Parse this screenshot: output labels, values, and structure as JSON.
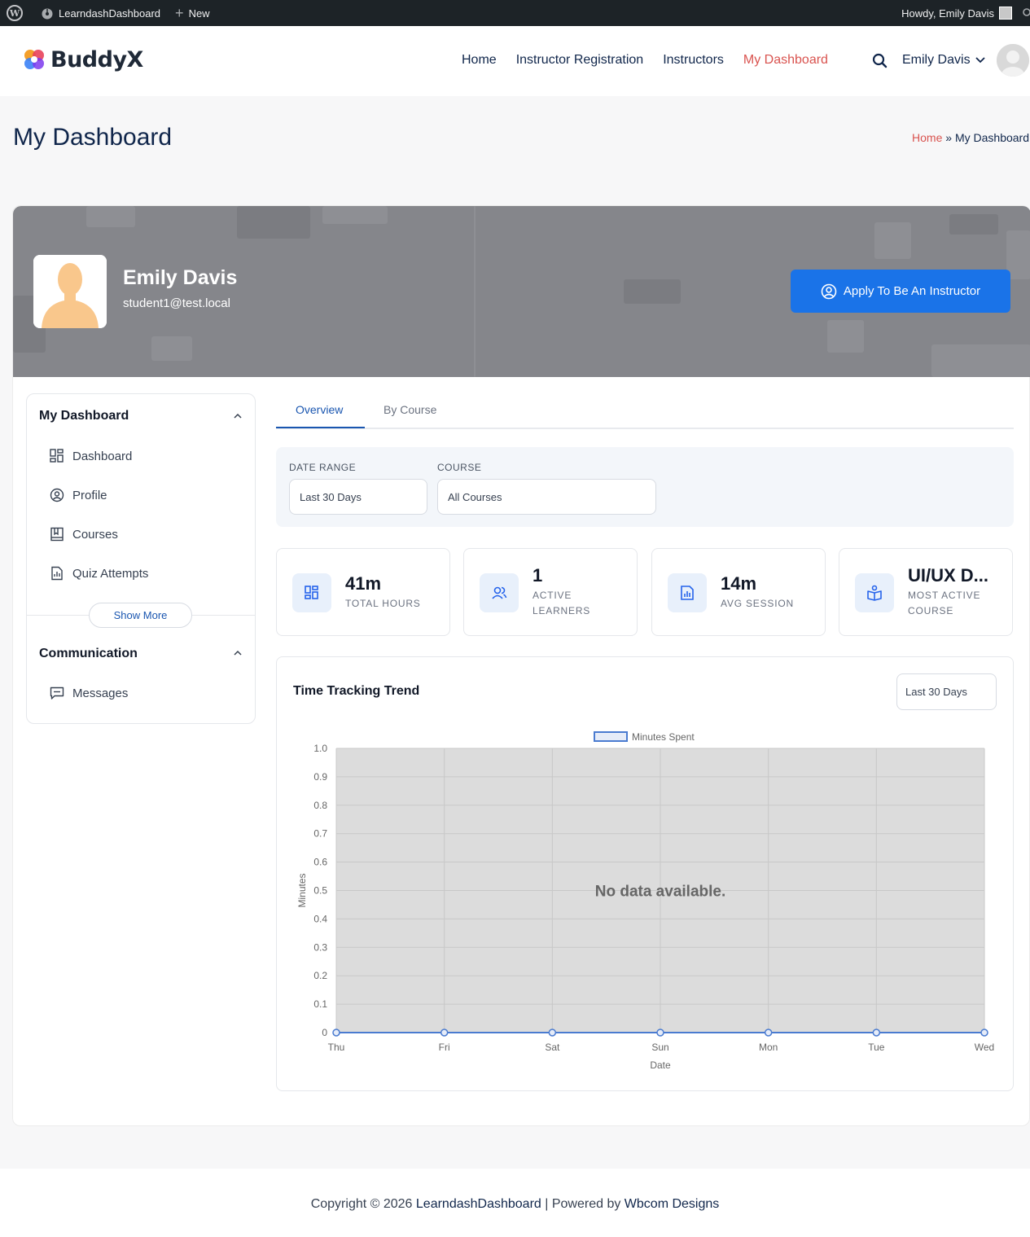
{
  "admin_bar": {
    "site_name": "LearndashDashboard",
    "new_label": "New",
    "howdy": "Howdy, Emily Davis"
  },
  "header": {
    "brand": "BuddyX",
    "nav": [
      {
        "label": "Home",
        "active": false
      },
      {
        "label": "Instructor Registration",
        "active": false
      },
      {
        "label": "Instructors",
        "active": false
      },
      {
        "label": "My Dashboard",
        "active": true
      }
    ],
    "user_name": "Emily Davis"
  },
  "page": {
    "title": "My Dashboard",
    "breadcrumb_home": "Home",
    "breadcrumb_sep": "»",
    "breadcrumb_current": "My Dashboard"
  },
  "profile": {
    "name": "Emily Davis",
    "email": "student1@test.local",
    "apply_label": "Apply To Be An Instructor"
  },
  "sidebar": {
    "section1_title": "My Dashboard",
    "items": [
      {
        "label": "Dashboard",
        "icon": "dashboard-icon"
      },
      {
        "label": "Profile",
        "icon": "profile-icon"
      },
      {
        "label": "Courses",
        "icon": "book-icon"
      },
      {
        "label": "Quiz Attempts",
        "icon": "report-icon"
      }
    ],
    "show_more": "Show More",
    "section2_title": "Communication",
    "messages": "Messages"
  },
  "tabs": [
    {
      "label": "Overview",
      "active": true
    },
    {
      "label": "By Course",
      "active": false
    }
  ],
  "filters": {
    "date_range_label": "DATE RANGE",
    "date_range_value": "Last 30 Days",
    "course_label": "COURSE",
    "course_value": "All Courses"
  },
  "stats": [
    {
      "value": "41m",
      "label_lines": [
        "TOTAL HOURS"
      ],
      "icon": "grid-icon"
    },
    {
      "value": "1",
      "label_lines": [
        "ACTIVE",
        "LEARNERS"
      ],
      "icon": "users-icon"
    },
    {
      "value": "14m",
      "label_lines": [
        "AVG SESSION"
      ],
      "icon": "chart-doc-icon"
    },
    {
      "value": "UI/UX D...",
      "label_lines": [
        "MOST ACTIVE",
        "COURSE"
      ],
      "icon": "course-icon"
    }
  ],
  "chart_card": {
    "title": "Time Tracking Trend",
    "range_value": "Last 30 Days"
  },
  "chart_data": {
    "type": "line",
    "x": [
      "Thu",
      "Fri",
      "Sat",
      "Sun",
      "Mon",
      "Tue",
      "Wed"
    ],
    "series": [
      {
        "name": "Minutes Spent",
        "values": [
          0,
          0,
          0,
          0,
          0,
          0,
          0
        ]
      }
    ],
    "yticks": [
      "1.0",
      "0.9",
      "0.8",
      "0.7",
      "0.6",
      "0.5",
      "0.4",
      "0.3",
      "0.2",
      "0.1",
      "0"
    ],
    "ylim": [
      0,
      1.0
    ],
    "xlabel": "Date",
    "ylabel": "Minutes",
    "message": "No data available.",
    "legend": "top-center",
    "grid": true,
    "colors": {
      "line": "#4a7bd0",
      "plot_bg": "#dcdcdc"
    }
  },
  "footer": {
    "prefix": "Copyright © 2026",
    "site": "LearndashDashboard",
    "middle": "| Powered by",
    "company": "Wbcom Designs"
  }
}
